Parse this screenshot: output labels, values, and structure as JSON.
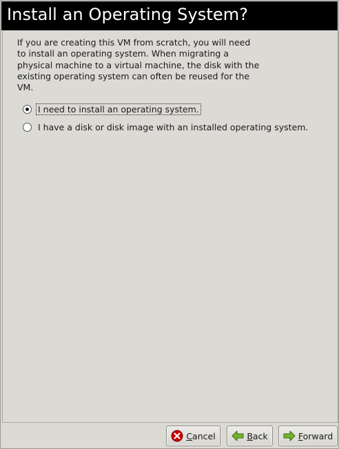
{
  "header": {
    "title": "Install an Operating System?"
  },
  "intro_text": "If you are creating this VM from scratch, you will need\nto install an operating system.  When migrating a\nphysical machine to a virtual machine, the disk with the\nexisting operating system can often be reused for the\nVM.",
  "options": [
    {
      "label": "I need to install an operating system.",
      "selected": true
    },
    {
      "label": "I have a disk or disk image with an installed operating system.",
      "selected": false
    }
  ],
  "buttons": {
    "cancel": {
      "mnemonic": "C",
      "rest": "ancel",
      "icon": "cancel-icon"
    },
    "back": {
      "mnemonic": "B",
      "rest": "ack",
      "icon": "back-arrow-icon"
    },
    "forward": {
      "mnemonic": "F",
      "rest": "orward",
      "icon": "forward-arrow-icon"
    }
  },
  "colors": {
    "header_bg": "#000000",
    "window_bg": "#dcdad5",
    "arrow_green": "#4e9a06",
    "cancel_red": "#cc0000"
  }
}
